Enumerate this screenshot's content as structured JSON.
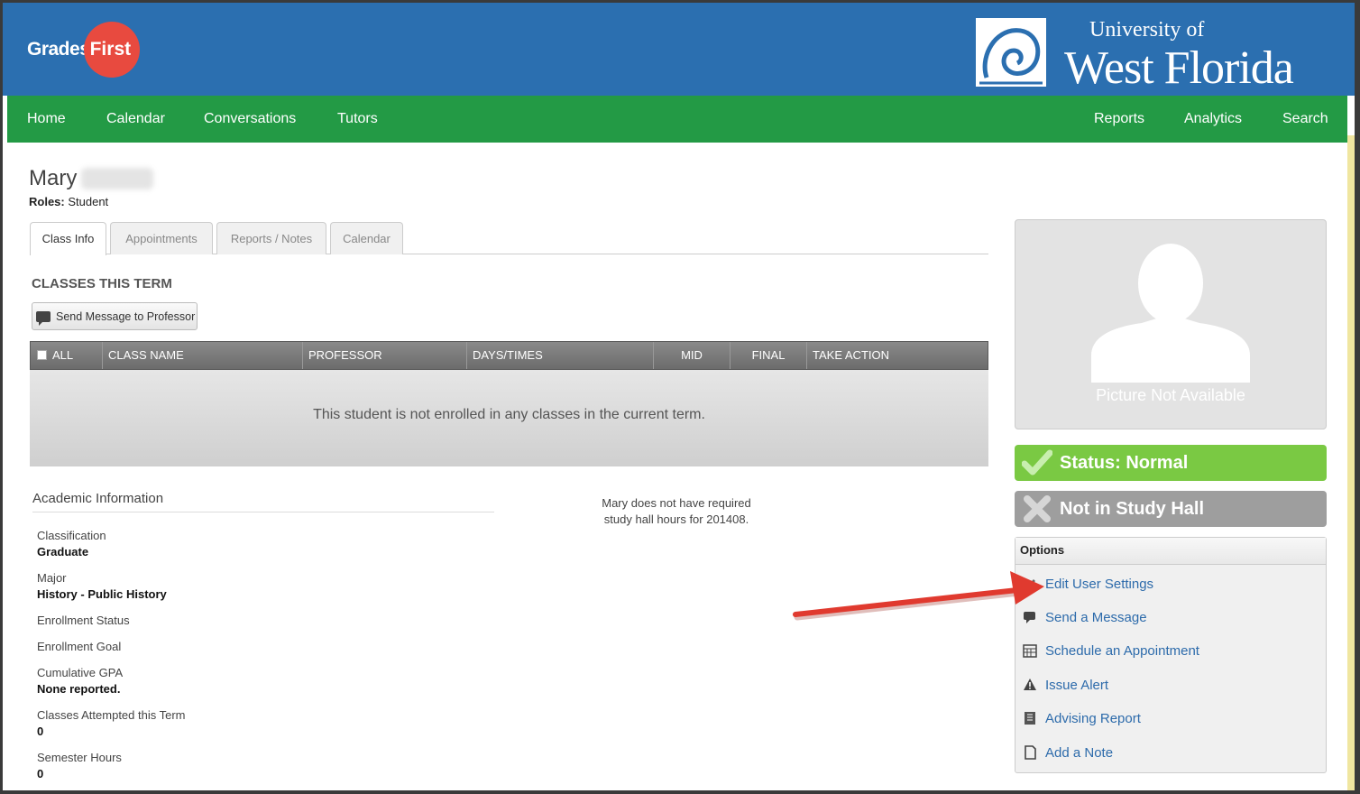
{
  "header": {
    "logo_grades": "Grades",
    "logo_first": "First",
    "university_top": "University of",
    "university_name": "West Florida"
  },
  "nav": {
    "left": [
      "Home",
      "Calendar",
      "Conversations",
      "Tutors"
    ],
    "right": [
      "Reports",
      "Analytics",
      "Search"
    ]
  },
  "profile": {
    "first_name": "Mary",
    "roles_label": "Roles:",
    "roles_value": " Student"
  },
  "tabs": [
    "Class Info",
    "Appointments",
    "Reports / Notes",
    "Calendar"
  ],
  "classes": {
    "title": "CLASSES THIS TERM",
    "send_button": "Send Message to Professor",
    "columns": [
      "ALL",
      "CLASS NAME",
      "PROFESSOR",
      "DAYS/TIMES",
      "MID",
      "FINAL",
      "TAKE ACTION"
    ],
    "empty_message": "This student is not enrolled in any classes in the current term."
  },
  "academic": {
    "title": "Academic Information",
    "fields": [
      {
        "label": "Classification",
        "value": "Graduate"
      },
      {
        "label": "Major",
        "value": "History - Public History"
      },
      {
        "label": "Enrollment Status",
        "value": ""
      },
      {
        "label": "Enrollment Goal",
        "value": ""
      },
      {
        "label": "Cumulative GPA",
        "value": "None reported."
      },
      {
        "label": "Classes Attempted this Term",
        "value": "0"
      },
      {
        "label": "Semester Hours",
        "value": "0"
      }
    ]
  },
  "study_hall": {
    "line1": "Mary does not have required",
    "line2": "study hall hours for 201408."
  },
  "picture": {
    "caption": "Picture Not Available"
  },
  "status": {
    "normal": "Status: Normal",
    "study_hall": "Not in Study Hall"
  },
  "options": {
    "title": "Options",
    "items": [
      {
        "label": "Edit User Settings",
        "icon": "pencil-icon"
      },
      {
        "label": "Send a Message",
        "icon": "chat-icon"
      },
      {
        "label": "Schedule an Appointment",
        "icon": "calendar-icon"
      },
      {
        "label": "Issue Alert",
        "icon": "warning-icon"
      },
      {
        "label": "Advising Report",
        "icon": "report-icon"
      },
      {
        "label": "Add a Note",
        "icon": "note-icon"
      }
    ]
  },
  "colors": {
    "header_blue": "#2b6fb0",
    "nav_green": "#239a45",
    "status_green": "#7ac943",
    "status_gray": "#9e9e9e",
    "link_blue": "#2d6bab",
    "arrow_red": "#e03a2f"
  }
}
